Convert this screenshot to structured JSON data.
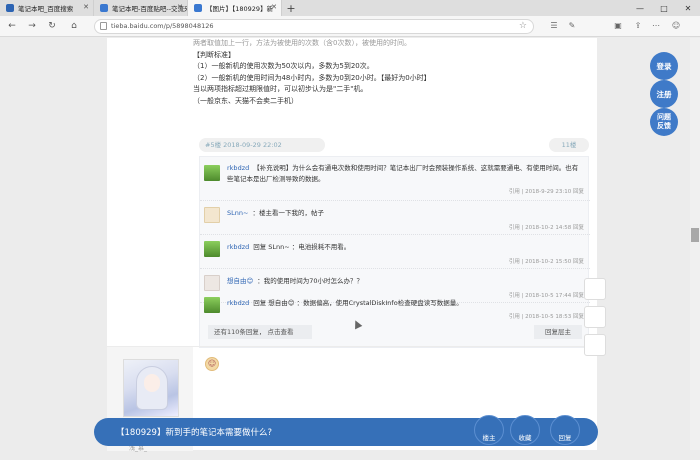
{
  "tabs": [
    {
      "label": "笔记本吧_百度搜索",
      "icon_color": "#2d64b3"
    },
    {
      "label": "笔记本吧-百度贴吧--交流来",
      "icon_color": "#3a78d0"
    },
    {
      "label": "【图片】【180929】新",
      "icon_color": "#3a78d0"
    }
  ],
  "window": {
    "minimize": "—",
    "maximize": "□",
    "close": "✕"
  },
  "address": {
    "url": "tieba.baidu.com/p/5898048126"
  },
  "reply_lines": [
    "两者取值加上一行，方法为被使用的次数（含0次数），被使用的时间。",
    "【判断标准】",
    "（1）一般新机的使用次数为50次以内，多数为5到20次。",
    "（2）一般新机的使用时间为48小时内，多数为0到20小时。【最好为0小时】",
    "当以两项指标超过期限值时，可以初步认为是\"二手\"机。",
    "（一般京东、天猫不会卖二手机）"
  ],
  "floor": {
    "meta": "#5楼  2018-09-29 22:02",
    "count": "11楼"
  },
  "lzl": [
    {
      "user": "rkbdzd",
      "text": "【补充说明】为什么会有通电次数和使用时间？笔记本出厂时会预装操作系统、这就需要通电、有使用时间。也有些笔记本是出厂检测导致的数据。",
      "time": "引用 | 2018-9-29 23:10  回复",
      "avatar_color": "#6aa84f"
    },
    {
      "user": "SLnn~",
      "text": "：楼主看一下我的，帖子",
      "time": "引用 | 2018-10-2 14:58  回复",
      "avatar_color": "#f1e3c8"
    },
    {
      "user": "rkbdzd",
      "text": "回复 SLnn~ ：电池损耗不用看。",
      "time": "引用 | 2018-10-2 15:50  回复",
      "avatar_color": "#6aa84f"
    },
    {
      "user": "想自由😊",
      "text": "：我的使用时间为70小时怎么办？？",
      "time": "引用 | 2018-10-5 17:44  回复",
      "avatar_color": "#e8e0dc"
    },
    {
      "user": "rkbdzd",
      "text": "回复 想自由😊 ：数据偏高，使用CrystalDiskInfo检查硬盘读写数据量。",
      "time": "引用 | 2018-10-5 18:53  回复",
      "avatar_color": "#6aa84f"
    }
  ],
  "lzl_more": "还有110条回复，  点击查看",
  "lzl_reply": "回复层主",
  "post2": {
    "name": "浅_慕_"
  },
  "side_buttons": [
    "登录",
    "注册",
    "问题反馈"
  ],
  "bottom": {
    "title": "【180929】新到手的笔记本需要做什么?",
    "buttons": [
      "楼主",
      "收藏",
      "回复"
    ]
  }
}
